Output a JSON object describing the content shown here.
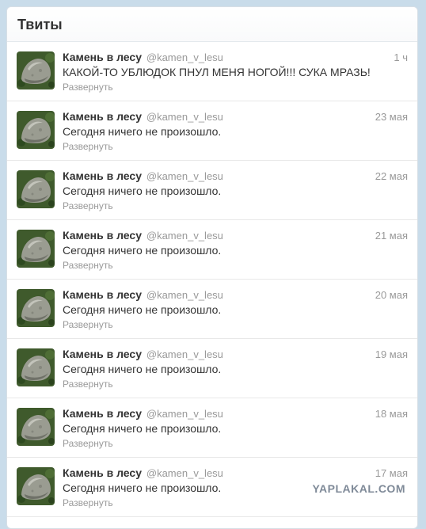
{
  "header": {
    "title": "Твиты"
  },
  "tweets": [
    {
      "name": "Камень в лесу",
      "handle": "@kamen_v_lesu",
      "time": "1 ч",
      "text": "КАКОЙ-ТО УБЛЮДОК ПНУЛ МЕНЯ НОГОЙ!!! СУКА МРАЗЬ!",
      "expand": "Развернуть"
    },
    {
      "name": "Камень в лесу",
      "handle": "@kamen_v_lesu",
      "time": "23 мая",
      "text": "Сегодня ничего не произошло.",
      "expand": "Развернуть"
    },
    {
      "name": "Камень в лесу",
      "handle": "@kamen_v_lesu",
      "time": "22 мая",
      "text": "Сегодня ничего не произошло.",
      "expand": "Развернуть"
    },
    {
      "name": "Камень в лесу",
      "handle": "@kamen_v_lesu",
      "time": "21 мая",
      "text": "Сегодня ничего не произошло.",
      "expand": "Развернуть"
    },
    {
      "name": "Камень в лесу",
      "handle": "@kamen_v_lesu",
      "time": "20 мая",
      "text": "Сегодня ничего не произошло.",
      "expand": "Развернуть"
    },
    {
      "name": "Камень в лесу",
      "handle": "@kamen_v_lesu",
      "time": "19 мая",
      "text": "Сегодня ничего не произошло.",
      "expand": "Развернуть"
    },
    {
      "name": "Камень в лесу",
      "handle": "@kamen_v_lesu",
      "time": "18 мая",
      "text": "Сегодня ничего не произошло.",
      "expand": "Развернуть"
    },
    {
      "name": "Камень в лесу",
      "handle": "@kamen_v_lesu",
      "time": "17 мая",
      "text": "Сегодня ничего не произошло.",
      "expand": "Развернуть"
    }
  ],
  "watermark": "YAPLAKAL.COM",
  "colors": {
    "background": "#c9dcea",
    "text": "#333333",
    "muted": "#999999"
  }
}
